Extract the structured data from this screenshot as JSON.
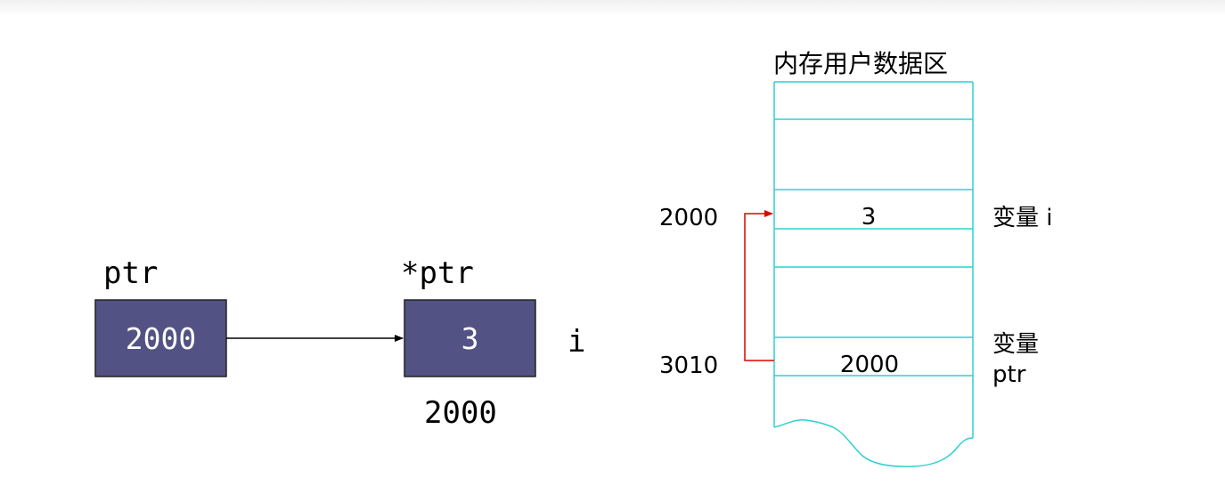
{
  "left": {
    "ptr_label": "ptr",
    "ptr_value": "2000",
    "deref_label": "*ptr",
    "deref_value": "3",
    "i_label": "i",
    "i_address": "2000"
  },
  "right": {
    "title": "内存用户数据区",
    "cell_i_value": "3",
    "cell_ptr_value": "2000",
    "addr_i": "2000",
    "addr_ptr": "3010",
    "var_i_label": "变量 i",
    "var_ptr_label_line1": "变量",
    "var_ptr_label_line2": "ptr"
  },
  "colors": {
    "box_fill": "#525284",
    "box_text": "#ffffff",
    "memory_stroke": "#2fd0d0",
    "pointer_arrow": "#e00000"
  }
}
